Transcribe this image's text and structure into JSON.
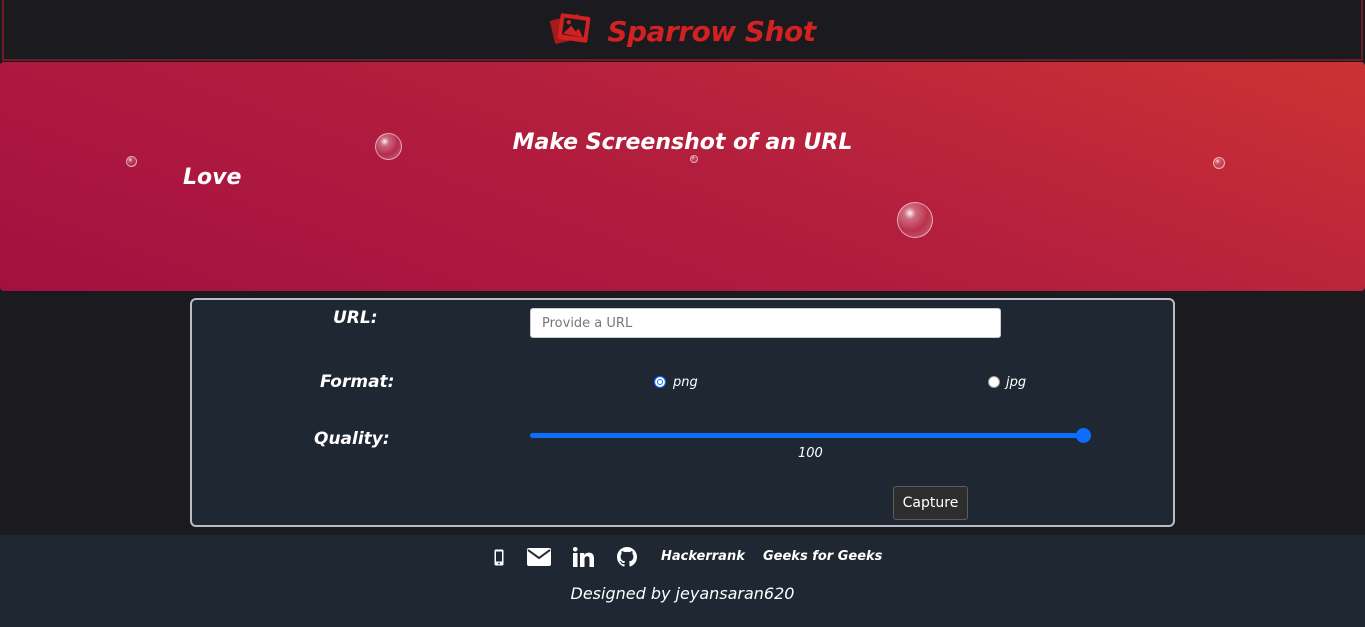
{
  "header": {
    "brand_name": "Sparrow Shot",
    "logo_icon": "images-icon",
    "brand_color": "#d12121"
  },
  "hero": {
    "title": "Make Screenshot of an URL",
    "tagline": "Love"
  },
  "form": {
    "url_label": "URL:",
    "url_placeholder": "Provide a URL",
    "url_value": "",
    "format_label": "Format:",
    "format_options": [
      {
        "label": "png",
        "selected": true
      },
      {
        "label": "jpg",
        "selected": false
      }
    ],
    "quality_label": "Quality:",
    "quality_value": "100",
    "capture_label": "Capture"
  },
  "footer": {
    "icons": [
      "mobile-icon",
      "envelope-icon",
      "linkedin-icon",
      "github-icon"
    ],
    "links": [
      "Hackerrank",
      "Geeks for Geeks"
    ],
    "credit": "Designed by jeyansaran620"
  },
  "colors": {
    "accent": "#0d6efd",
    "hero_start": "#a31040",
    "hero_end": "#cc3233",
    "panel_bg": "#1f2733"
  }
}
